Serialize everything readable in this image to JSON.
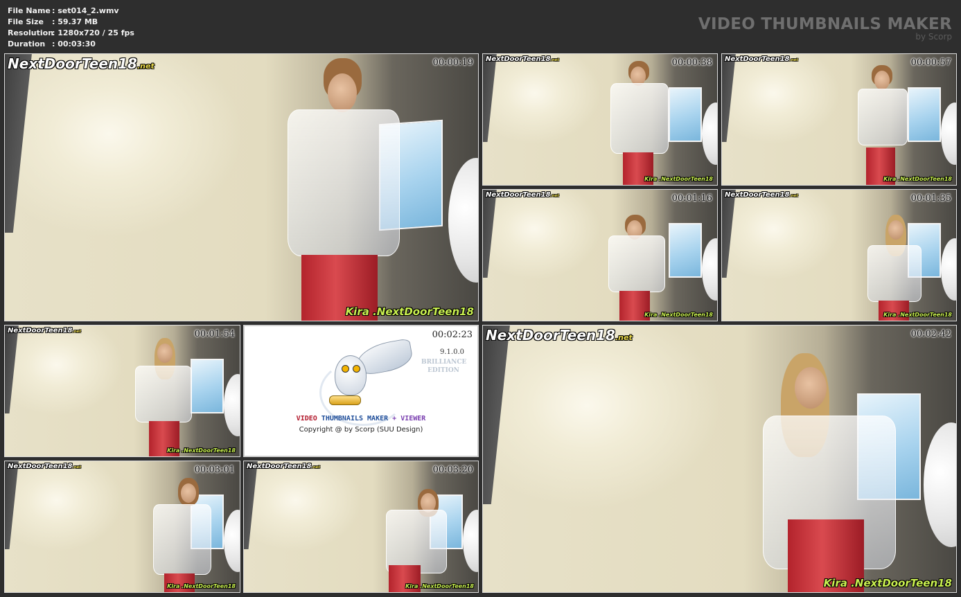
{
  "info": {
    "rows": [
      {
        "key": "File Name",
        "value": ": set014_2.wmv"
      },
      {
        "key": "File Size",
        "value": ": 59.37 MB"
      },
      {
        "key": "Resolution",
        "value": ": 1280x720 / 25 fps"
      },
      {
        "key": "Duration",
        "value": ": 00:03:30"
      }
    ]
  },
  "brand": {
    "title": "VIDEO THUMBNAILS MAKER",
    "subtitle": "by Scorp"
  },
  "overlay": {
    "logo": "NextDoorTeen18",
    "logo_suffix": ".net",
    "watermark": "Kira .NextDoorTeen18"
  },
  "thumbnails": [
    {
      "time": "00:00:19"
    },
    {
      "time": "00:00:38"
    },
    {
      "time": "00:00:57"
    },
    {
      "time": "00:01:16"
    },
    {
      "time": "00:01:35"
    },
    {
      "time": "00:01:54"
    },
    {
      "time": "00:02:23"
    },
    {
      "time": "00:02:42"
    },
    {
      "time": "00:03:01"
    },
    {
      "time": "00:03:20"
    }
  ],
  "splash": {
    "version": "9.1.0.0",
    "edition_line1": "BRILLIANCE",
    "edition_line2": "EDITION",
    "title_part1": "VIDEO",
    "title_part2": "THUMBNAILS MAKER",
    "title_part3": "+ VIEWER",
    "copyright": "Copyright @ by Scorp (SUU Design)",
    "colors": {
      "red": "#b2182b",
      "blue": "#1f4e9a",
      "purple": "#7a3fb0"
    }
  }
}
